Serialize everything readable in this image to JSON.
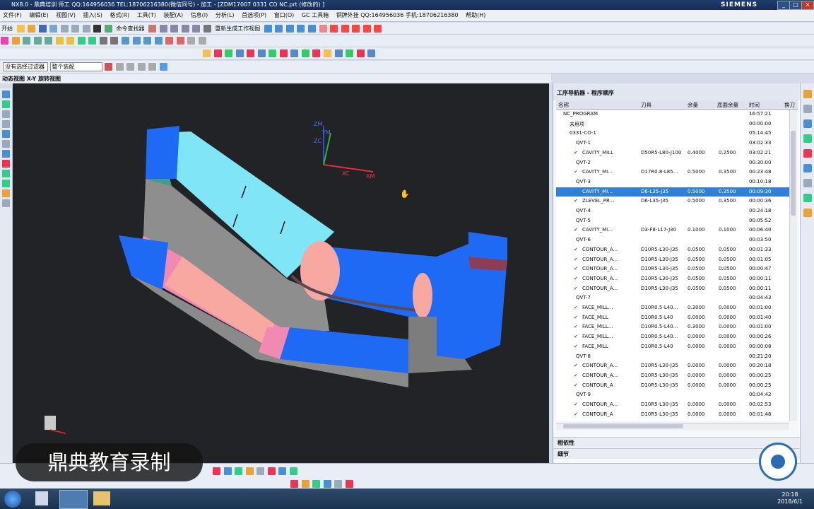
{
  "window": {
    "title": "NX8.0 - 鼎典培训 师工 QQ:164956036 TEL:18706216380(微信同号)  - 加工 - [ZDM17007 0331 CO NC.prt (修改的) ]",
    "brand": "SIEMENS"
  },
  "menu": [
    "文件(F)",
    "编辑(E)",
    "视图(V)",
    "插入(S)",
    "格式(R)",
    "工具(T)",
    "装配(A)",
    "信息(I)",
    "分析(L)",
    "首选项(P)",
    "窗口(O)",
    "GC 工具箱",
    "帮助(H)"
  ],
  "menu_note": "铜牌外挂 QQ:164956036 手机:18706216380",
  "toolbar1": {
    "start_label": "开始",
    "command_finder": "命令查找器",
    "regen": "重新生成工作视图"
  },
  "filters": {
    "select_filter": "没有选择过滤器",
    "assembly_scope": "整个装配"
  },
  "view_title": "动态视图 X-Y 旋转视图",
  "navigator": {
    "title": "工序导航器 - 程序顺序",
    "columns": [
      "名称",
      "刀具",
      "余量",
      "底面余量",
      "时间",
      "换刀"
    ],
    "rows": [
      {
        "name": "NC_PROGRAM",
        "tool": "",
        "stock": "",
        "floor": "",
        "time": "16:57:21",
        "depth": 0
      },
      {
        "name": "未用项",
        "tool": "",
        "stock": "",
        "floor": "",
        "time": "00:00:00",
        "depth": 1
      },
      {
        "name": "0331-CO-1",
        "tool": "",
        "stock": "",
        "floor": "",
        "time": "05:14:45",
        "depth": 1
      },
      {
        "name": "QVT-1",
        "tool": "",
        "stock": "",
        "floor": "",
        "time": "03:02:33",
        "depth": 2
      },
      {
        "name": "CAVITY_MILL",
        "tool": "D50R5-L80-J100",
        "stock": "0.4000",
        "floor": "0.2500",
        "time": "03:02:21",
        "depth": 3
      },
      {
        "name": "QVT-2",
        "tool": "",
        "stock": "",
        "floor": "",
        "time": "00:30:00",
        "depth": 2
      },
      {
        "name": "CAVITY_MI...",
        "tool": "D17R0.8-L85...",
        "stock": "0.5000",
        "floor": "0.3500",
        "time": "00:23:48",
        "depth": 3
      },
      {
        "name": "QVT-3",
        "tool": "",
        "stock": "",
        "floor": "",
        "time": "00:10:18",
        "depth": 2
      },
      {
        "name": "CAVITY_MI...",
        "tool": "D6-L35-J35",
        "stock": "0.5000",
        "floor": "0.3500",
        "time": "00:09:30",
        "depth": 3,
        "selected": true
      },
      {
        "name": "ZLEVEL_PR...",
        "tool": "D6-L35-J35",
        "stock": "0.5000",
        "floor": "0.3500",
        "time": "00:00:36",
        "depth": 3
      },
      {
        "name": "QVT-4",
        "tool": "",
        "stock": "",
        "floor": "",
        "time": "00:24:18",
        "depth": 2
      },
      {
        "name": "QVT-5",
        "tool": "",
        "stock": "",
        "floor": "",
        "time": "00:05:52",
        "depth": 2
      },
      {
        "name": "CAVITY_MI...",
        "tool": "D3-F8-L17-J30",
        "stock": "0.1000",
        "floor": "0.1000",
        "time": "00:06:40",
        "depth": 3
      },
      {
        "name": "QVT-6",
        "tool": "",
        "stock": "",
        "floor": "",
        "time": "00:03:50",
        "depth": 2
      },
      {
        "name": "CONTOUR_A...",
        "tool": "D10R5-L30-J35",
        "stock": "0.0500",
        "floor": "0.0500",
        "time": "00:01:33",
        "depth": 3
      },
      {
        "name": "CONTOUR_A...",
        "tool": "D10R5-L30-J35",
        "stock": "0.0500",
        "floor": "0.0500",
        "time": "00:01:05",
        "depth": 3
      },
      {
        "name": "CONTOUR_A...",
        "tool": "D10R5-L30-J35",
        "stock": "0.0500",
        "floor": "0.0500",
        "time": "00:00:47",
        "depth": 3
      },
      {
        "name": "CONTOUR_A...",
        "tool": "D10R5-L30-J35",
        "stock": "0.0500",
        "floor": "0.0500",
        "time": "00:00:11",
        "depth": 3
      },
      {
        "name": "CONTOUR_A...",
        "tool": "D10R5-L30-J35",
        "stock": "0.0500",
        "floor": "0.0500",
        "time": "00:00:11",
        "depth": 3
      },
      {
        "name": "QVT-7",
        "tool": "",
        "stock": "",
        "floor": "",
        "time": "00:04:43",
        "depth": 2
      },
      {
        "name": "FACE_MILL...",
        "tool": "D10R0.5-L40...",
        "stock": "0.3000",
        "floor": "0.0000",
        "time": "00:01:00",
        "depth": 3
      },
      {
        "name": "FACE_MILL",
        "tool": "D10R0.5-L40",
        "stock": "0.0000",
        "floor": "0.0000",
        "time": "00:01:40",
        "depth": 3
      },
      {
        "name": "FACE_MILL...",
        "tool": "D10R0.5-L40...",
        "stock": "0.3000",
        "floor": "0.0000",
        "time": "00:01:00",
        "depth": 3
      },
      {
        "name": "FACE_MILL...",
        "tool": "D10R0.5-L40...",
        "stock": "0.0000",
        "floor": "0.0000",
        "time": "00:00:26",
        "depth": 3
      },
      {
        "name": "FACE_MILL",
        "tool": "D10R0.5-L40",
        "stock": "0.0000",
        "floor": "0.0000",
        "time": "00:00:08",
        "depth": 3
      },
      {
        "name": "QVT-8",
        "tool": "",
        "stock": "",
        "floor": "",
        "time": "00:21:20",
        "depth": 2
      },
      {
        "name": "CONTOUR_A...",
        "tool": "D10R5-L30-J35",
        "stock": "0.0000",
        "floor": "0.0000",
        "time": "00:20:18",
        "depth": 3
      },
      {
        "name": "CONTOUR_A...",
        "tool": "D10R5-L30-J35",
        "stock": "0.0000",
        "floor": "0.0000",
        "time": "00:00:25",
        "depth": 3
      },
      {
        "name": "CONTOUR_A",
        "tool": "D10R5-L30-J35",
        "stock": "0.0000",
        "floor": "0.0000",
        "time": "00:00:25",
        "depth": 3
      },
      {
        "name": "QVT-9",
        "tool": "",
        "stock": "",
        "floor": "",
        "time": "00:04:42",
        "depth": 2
      },
      {
        "name": "CONTOUR_A...",
        "tool": "D10R5-L30-J35",
        "stock": "0.0000",
        "floor": "0.0000",
        "time": "00:02:53",
        "depth": 3
      },
      {
        "name": "CONTOUR_A",
        "tool": "D10R5-L30-J35",
        "stock": "0.0000",
        "floor": "0.0000",
        "time": "00:01:48",
        "depth": 3
      }
    ],
    "sections": [
      "相依性",
      "细节"
    ]
  },
  "axis_labels": {
    "zm": "ZM",
    "ym": "YM",
    "zc": "ZC",
    "xc": "XC",
    "xm": "XM"
  },
  "watermark": "鼎典教育录制",
  "taskbar": {
    "time": "20:18",
    "date": "2018/6/1"
  },
  "colors": {
    "viewport_bg": "#222326",
    "face_blue": "#1f6af5",
    "face_cyan": "#80e6f7",
    "face_gray": "#8e8e8e",
    "face_pink": "#f08ab3",
    "face_salmon": "#f7a8a0",
    "selection": "#2f7fe0"
  }
}
